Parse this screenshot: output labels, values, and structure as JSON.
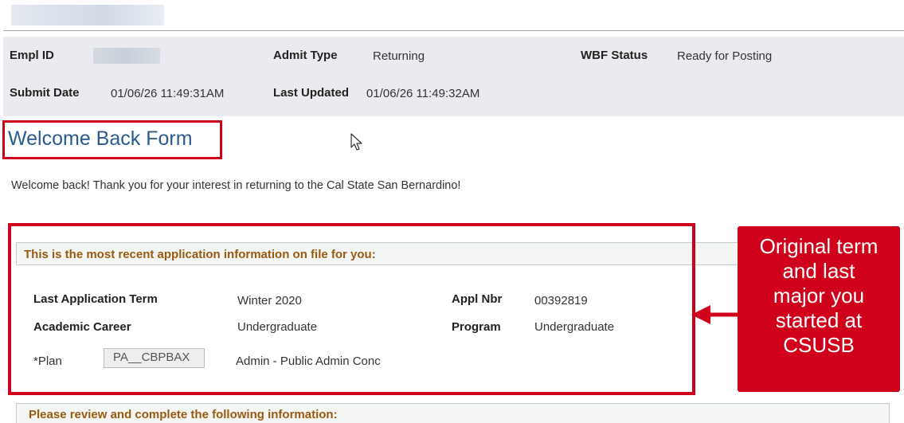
{
  "header": {
    "empl_id_label": "Empl ID",
    "admit_type_label": "Admit Type",
    "admit_type_value": "Returning",
    "wbf_status_label": "WBF Status",
    "wbf_status_value": "Ready for Posting",
    "submit_date_label": "Submit Date",
    "submit_date_value": "01/06/26 11:49:31AM",
    "last_updated_label": "Last Updated",
    "last_updated_value": "01/06/26 11:49:32AM"
  },
  "form": {
    "title": "Welcome Back Form",
    "intro": "Welcome back! Thank you for your interest in returning to the Cal State San Bernardino!"
  },
  "recent_application": {
    "heading": "This is the most recent application information on file for you:",
    "last_term_label": "Last Application Term",
    "last_term_value": "Winter 2020",
    "appl_nbr_label": "Appl Nbr",
    "appl_nbr_value": "00392819",
    "career_label": "Academic Career",
    "career_value": "Undergraduate",
    "program_label": "Program",
    "program_value": "Undergraduate",
    "plan_label": "*Plan",
    "plan_code": "PA__CBPBAX",
    "plan_description": "Admin - Public Admin Conc"
  },
  "callout": {
    "lines": [
      "Original term",
      "and last",
      "major you",
      "started at",
      "CSUSB"
    ]
  },
  "review": {
    "heading": "Please review and complete the following information:"
  },
  "colors": {
    "annotation_red": "#d0021b",
    "title_blue": "#2a5b8f",
    "section_heading": "#9b5a12",
    "header_panel_bg": "#ebebef"
  },
  "icons": {
    "cursor": "mouse-pointer-icon",
    "arrow": "arrow-left-icon"
  }
}
